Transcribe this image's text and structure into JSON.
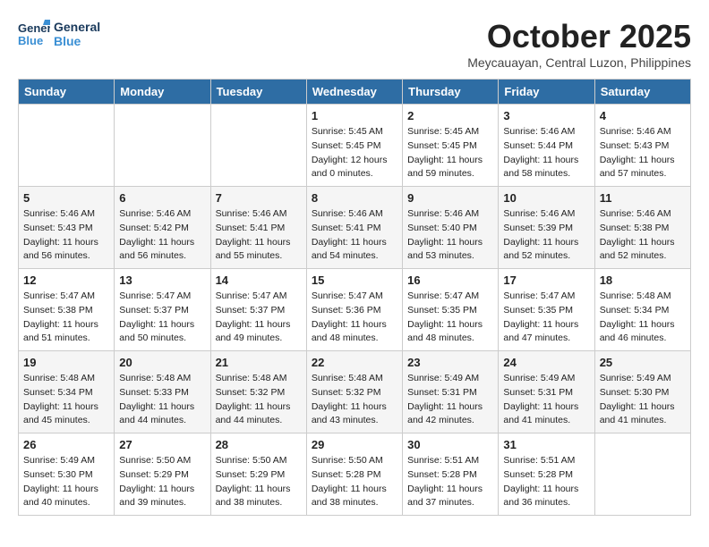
{
  "header": {
    "logo_line1": "General",
    "logo_line2": "Blue",
    "month": "October 2025",
    "location": "Meycauayan, Central Luzon, Philippines"
  },
  "weekdays": [
    "Sunday",
    "Monday",
    "Tuesday",
    "Wednesday",
    "Thursday",
    "Friday",
    "Saturday"
  ],
  "weeks": [
    [
      {
        "day": "",
        "sunrise": "",
        "sunset": "",
        "daylight": ""
      },
      {
        "day": "",
        "sunrise": "",
        "sunset": "",
        "daylight": ""
      },
      {
        "day": "",
        "sunrise": "",
        "sunset": "",
        "daylight": ""
      },
      {
        "day": "1",
        "sunrise": "Sunrise: 5:45 AM",
        "sunset": "Sunset: 5:45 PM",
        "daylight": "Daylight: 12 hours and 0 minutes."
      },
      {
        "day": "2",
        "sunrise": "Sunrise: 5:45 AM",
        "sunset": "Sunset: 5:45 PM",
        "daylight": "Daylight: 11 hours and 59 minutes."
      },
      {
        "day": "3",
        "sunrise": "Sunrise: 5:46 AM",
        "sunset": "Sunset: 5:44 PM",
        "daylight": "Daylight: 11 hours and 58 minutes."
      },
      {
        "day": "4",
        "sunrise": "Sunrise: 5:46 AM",
        "sunset": "Sunset: 5:43 PM",
        "daylight": "Daylight: 11 hours and 57 minutes."
      }
    ],
    [
      {
        "day": "5",
        "sunrise": "Sunrise: 5:46 AM",
        "sunset": "Sunset: 5:43 PM",
        "daylight": "Daylight: 11 hours and 56 minutes."
      },
      {
        "day": "6",
        "sunrise": "Sunrise: 5:46 AM",
        "sunset": "Sunset: 5:42 PM",
        "daylight": "Daylight: 11 hours and 56 minutes."
      },
      {
        "day": "7",
        "sunrise": "Sunrise: 5:46 AM",
        "sunset": "Sunset: 5:41 PM",
        "daylight": "Daylight: 11 hours and 55 minutes."
      },
      {
        "day": "8",
        "sunrise": "Sunrise: 5:46 AM",
        "sunset": "Sunset: 5:41 PM",
        "daylight": "Daylight: 11 hours and 54 minutes."
      },
      {
        "day": "9",
        "sunrise": "Sunrise: 5:46 AM",
        "sunset": "Sunset: 5:40 PM",
        "daylight": "Daylight: 11 hours and 53 minutes."
      },
      {
        "day": "10",
        "sunrise": "Sunrise: 5:46 AM",
        "sunset": "Sunset: 5:39 PM",
        "daylight": "Daylight: 11 hours and 52 minutes."
      },
      {
        "day": "11",
        "sunrise": "Sunrise: 5:46 AM",
        "sunset": "Sunset: 5:38 PM",
        "daylight": "Daylight: 11 hours and 52 minutes."
      }
    ],
    [
      {
        "day": "12",
        "sunrise": "Sunrise: 5:47 AM",
        "sunset": "Sunset: 5:38 PM",
        "daylight": "Daylight: 11 hours and 51 minutes."
      },
      {
        "day": "13",
        "sunrise": "Sunrise: 5:47 AM",
        "sunset": "Sunset: 5:37 PM",
        "daylight": "Daylight: 11 hours and 50 minutes."
      },
      {
        "day": "14",
        "sunrise": "Sunrise: 5:47 AM",
        "sunset": "Sunset: 5:37 PM",
        "daylight": "Daylight: 11 hours and 49 minutes."
      },
      {
        "day": "15",
        "sunrise": "Sunrise: 5:47 AM",
        "sunset": "Sunset: 5:36 PM",
        "daylight": "Daylight: 11 hours and 48 minutes."
      },
      {
        "day": "16",
        "sunrise": "Sunrise: 5:47 AM",
        "sunset": "Sunset: 5:35 PM",
        "daylight": "Daylight: 11 hours and 48 minutes."
      },
      {
        "day": "17",
        "sunrise": "Sunrise: 5:47 AM",
        "sunset": "Sunset: 5:35 PM",
        "daylight": "Daylight: 11 hours and 47 minutes."
      },
      {
        "day": "18",
        "sunrise": "Sunrise: 5:48 AM",
        "sunset": "Sunset: 5:34 PM",
        "daylight": "Daylight: 11 hours and 46 minutes."
      }
    ],
    [
      {
        "day": "19",
        "sunrise": "Sunrise: 5:48 AM",
        "sunset": "Sunset: 5:34 PM",
        "daylight": "Daylight: 11 hours and 45 minutes."
      },
      {
        "day": "20",
        "sunrise": "Sunrise: 5:48 AM",
        "sunset": "Sunset: 5:33 PM",
        "daylight": "Daylight: 11 hours and 44 minutes."
      },
      {
        "day": "21",
        "sunrise": "Sunrise: 5:48 AM",
        "sunset": "Sunset: 5:32 PM",
        "daylight": "Daylight: 11 hours and 44 minutes."
      },
      {
        "day": "22",
        "sunrise": "Sunrise: 5:48 AM",
        "sunset": "Sunset: 5:32 PM",
        "daylight": "Daylight: 11 hours and 43 minutes."
      },
      {
        "day": "23",
        "sunrise": "Sunrise: 5:49 AM",
        "sunset": "Sunset: 5:31 PM",
        "daylight": "Daylight: 11 hours and 42 minutes."
      },
      {
        "day": "24",
        "sunrise": "Sunrise: 5:49 AM",
        "sunset": "Sunset: 5:31 PM",
        "daylight": "Daylight: 11 hours and 41 minutes."
      },
      {
        "day": "25",
        "sunrise": "Sunrise: 5:49 AM",
        "sunset": "Sunset: 5:30 PM",
        "daylight": "Daylight: 11 hours and 41 minutes."
      }
    ],
    [
      {
        "day": "26",
        "sunrise": "Sunrise: 5:49 AM",
        "sunset": "Sunset: 5:30 PM",
        "daylight": "Daylight: 11 hours and 40 minutes."
      },
      {
        "day": "27",
        "sunrise": "Sunrise: 5:50 AM",
        "sunset": "Sunset: 5:29 PM",
        "daylight": "Daylight: 11 hours and 39 minutes."
      },
      {
        "day": "28",
        "sunrise": "Sunrise: 5:50 AM",
        "sunset": "Sunset: 5:29 PM",
        "daylight": "Daylight: 11 hours and 38 minutes."
      },
      {
        "day": "29",
        "sunrise": "Sunrise: 5:50 AM",
        "sunset": "Sunset: 5:28 PM",
        "daylight": "Daylight: 11 hours and 38 minutes."
      },
      {
        "day": "30",
        "sunrise": "Sunrise: 5:51 AM",
        "sunset": "Sunset: 5:28 PM",
        "daylight": "Daylight: 11 hours and 37 minutes."
      },
      {
        "day": "31",
        "sunrise": "Sunrise: 5:51 AM",
        "sunset": "Sunset: 5:28 PM",
        "daylight": "Daylight: 11 hours and 36 minutes."
      },
      {
        "day": "",
        "sunrise": "",
        "sunset": "",
        "daylight": ""
      }
    ]
  ]
}
